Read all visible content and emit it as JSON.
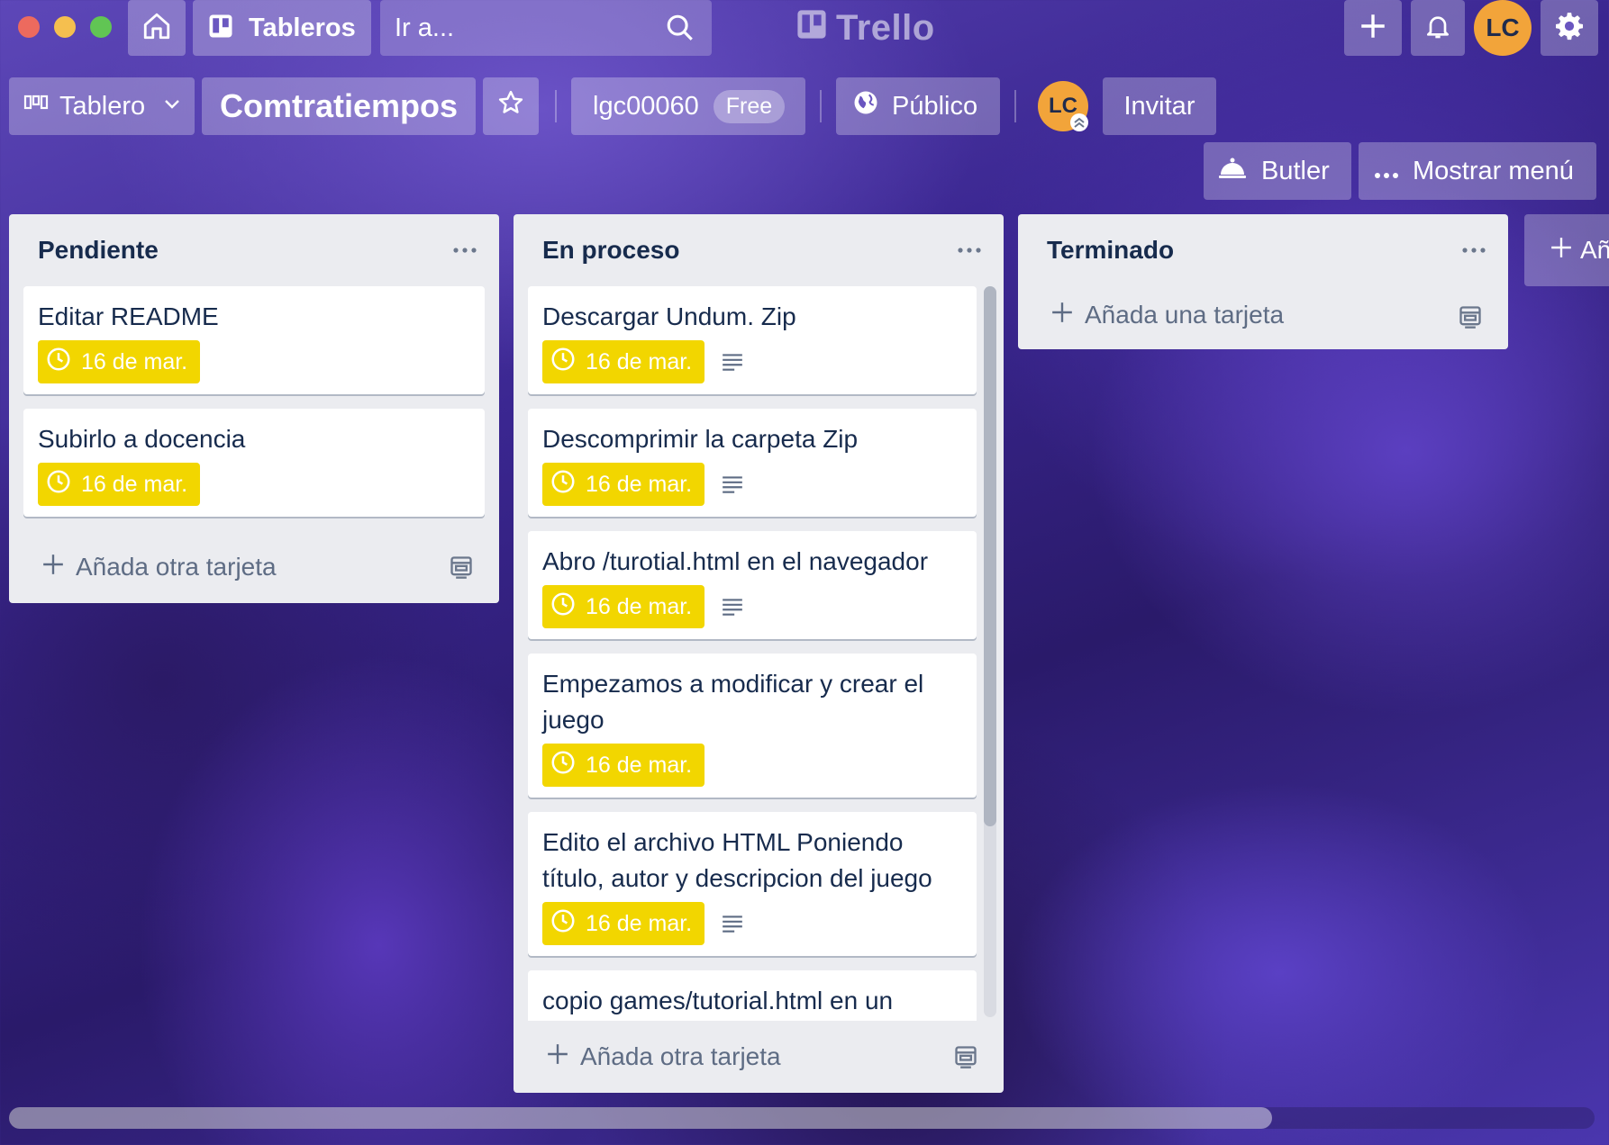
{
  "header": {
    "boards_label": "Tableros",
    "search_placeholder": "Ir a...",
    "logo_text": "Trello",
    "user_initials": "LC"
  },
  "board": {
    "view_label": "Tablero",
    "title": "Comtratiempos",
    "team_name": "lgc00060",
    "team_plan": "Free",
    "visibility": "Público",
    "member_initials": "LC",
    "invite_label": "Invitar",
    "butler_label": "Butler",
    "menu_label": "Mostrar menú"
  },
  "lists": [
    {
      "title": "Pendiente",
      "cards": [
        {
          "title": "Editar README",
          "due": "16 de mar.",
          "has_description": false
        },
        {
          "title": "Subirlo a docencia",
          "due": "16 de mar.",
          "has_description": false
        }
      ],
      "add_label": "Añada otra tarjeta"
    },
    {
      "title": "En proceso",
      "cards": [
        {
          "title": "Descargar Undum. Zip",
          "due": "16 de mar.",
          "has_description": true
        },
        {
          "title": "Descomprimir la carpeta Zip",
          "due": "16 de mar.",
          "has_description": true
        },
        {
          "title": "Abro /turotial.html en el navegador",
          "due": "16 de mar.",
          "has_description": true
        },
        {
          "title": "Empezamos a modificar y crear el juego",
          "due": "16 de mar.",
          "has_description": false
        },
        {
          "title": "Edito el archivo HTML Poniendo título, autor y descripcion del juego",
          "due": "16 de mar.",
          "has_description": true
        },
        {
          "title": "copio games/tutorial.html en un",
          "due": "",
          "has_description": false
        }
      ],
      "add_label": "Añada otra tarjeta"
    },
    {
      "title": "Terminado",
      "cards": [],
      "add_label": "Añada una tarjeta"
    }
  ],
  "add_list_label": "Añ",
  "colors": {
    "due_badge": "#f2d600",
    "list_bg": "#ebecf0",
    "avatar": "#f2a43a"
  }
}
